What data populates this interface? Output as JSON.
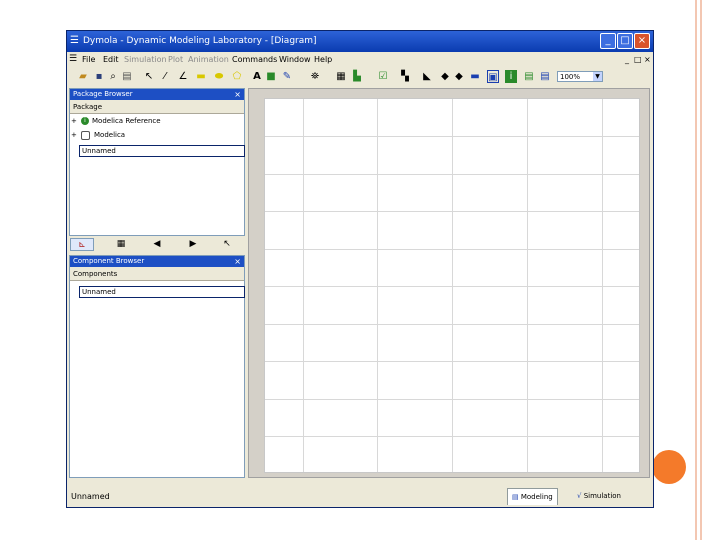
{
  "window": {
    "title": "Dymola - Dynamic Modeling Laboratory - [Diagram]",
    "controls": [
      "_",
      "□",
      "×"
    ],
    "mdi_controls": [
      "_",
      "□",
      "×"
    ]
  },
  "menu": {
    "items": [
      "File",
      "Edit",
      "Simulation",
      "Plot",
      "Animation",
      "Commands",
      "Window",
      "Help"
    ]
  },
  "toolbar": {
    "zoom": "100%"
  },
  "package_browser": {
    "title": "Package Browser",
    "close": "×",
    "column_header": "Package",
    "items": [
      {
        "expander": "+",
        "label": "Modelica Reference"
      },
      {
        "expander": "+",
        "label": "Modelica"
      }
    ],
    "selected": "Unnamed"
  },
  "component_browser": {
    "title": "Component Browser",
    "close": "×",
    "column_header": "Components",
    "selected": "Unnamed"
  },
  "status": {
    "text": "Unnamed",
    "modes": [
      "Modeling",
      "Simulation"
    ]
  }
}
